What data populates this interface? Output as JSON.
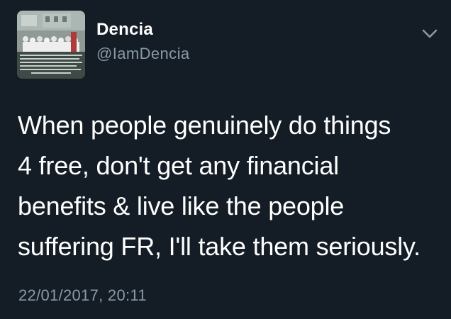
{
  "tweet": {
    "author": {
      "display_name": "Dencia",
      "handle": "@IamDencia",
      "avatar_icon": "profile-photo-group"
    },
    "text": "When people genuinely do things\n4 free, don't get any financial\nbenefits & live like the people\nsuffering FR, I'll take them seriously.",
    "timestamp": "22/01/2017, 20:11",
    "menu_icon": "chevron-down-icon"
  },
  "colors": {
    "background": "#141d26",
    "primary_text": "#ffffff",
    "secondary_text": "#8899a6"
  }
}
